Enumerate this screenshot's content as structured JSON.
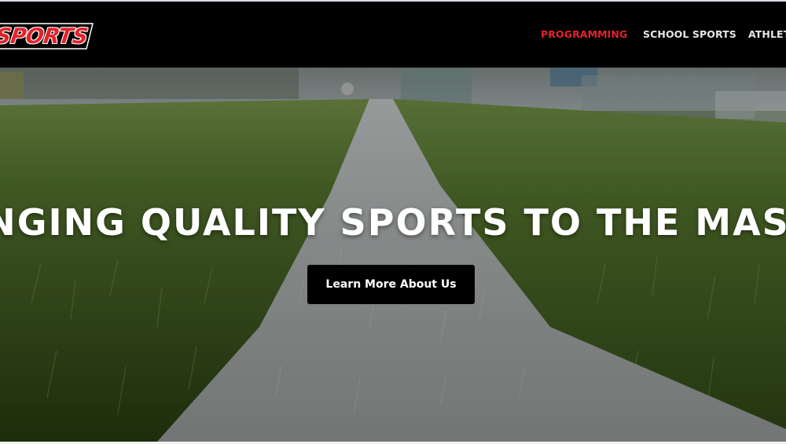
{
  "brand": {
    "logo_text": "SPORTS",
    "logo_color": "#e3232b"
  },
  "nav": {
    "items": [
      {
        "label": "PROGRAMMING",
        "active": true
      },
      {
        "label": "SCHOOL SPORTS",
        "active": false
      },
      {
        "label": "ATHLET",
        "active": false
      }
    ],
    "active_color": "#e3232b",
    "text_color": "#e8e8e8",
    "background": "#000000"
  },
  "hero": {
    "headline": "INGING QUALITY SPORTS TO THE MASS",
    "cta_label": "Learn More About Us",
    "image": "turf-field-white-line"
  }
}
